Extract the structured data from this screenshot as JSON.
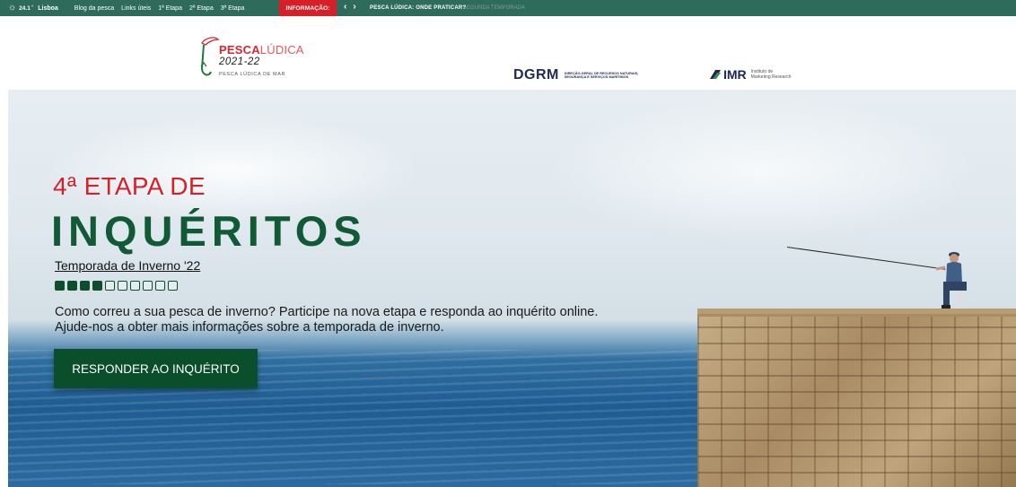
{
  "topbar": {
    "weather_icon": "sun-icon",
    "temperature": "24.1",
    "degree": "°",
    "city": "Lisboa",
    "nav": [
      "Blog da pesca",
      "Links úteis",
      "1ª Etapa",
      "2ª Etapa",
      "3ª Etapa"
    ],
    "info_label": "INFORMAÇÃO:",
    "prev_icon": "‹",
    "next_icon": "›",
    "headline": "PESCA LÚDICA: ONDE PRATICAR?",
    "headline_fade": "SEGUNDA TEMPORADA",
    "bar_color": "#2f6b5a",
    "info_color": "#d61f26"
  },
  "logos": {
    "pesca_bold": "PESCA",
    "pesca_light": "LÚDICA",
    "pesca_year": "2021-22",
    "pesca_sub": "PESCA LÚDICA DE MAR",
    "dgrm_word": "DGRM",
    "dgrm_text": "DIREÇÃO-GERAL DE RECURSOS NATURAIS, SEGURANÇA E SERVIÇOS MARÍTIMOS",
    "imr_word": "IMR",
    "imr_text_1": "Instituto de",
    "imr_text_2": "Marketing Research"
  },
  "hero": {
    "eyebrow": "4ª ETAPA DE",
    "title": "INQUÉRITOS",
    "season": "Temporada de Inverno '22",
    "steps_total": 10,
    "steps_done": 4,
    "desc_line1": "Como correu a sua pesca de inverno? Participe na nova etapa e responda ao inquérito online.",
    "desc_line2": "Ajude-nos a obter mais informações sobre a temporada de inverno.",
    "button_label": "RESPONDER AO INQUÉRITO",
    "accent_red": "#d2232a",
    "accent_green": "#115a36"
  }
}
